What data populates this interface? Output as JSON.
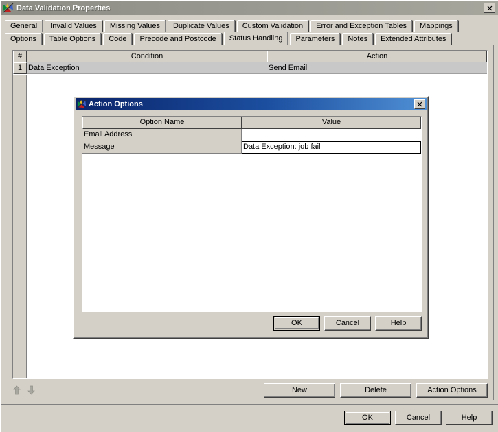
{
  "window": {
    "title": "Data Validation Properties",
    "icon": "app-butterfly-icon",
    "close_label": "✕"
  },
  "tabs": {
    "row1": [
      {
        "label": "General",
        "selected": false
      },
      {
        "label": "Invalid Values",
        "selected": false
      },
      {
        "label": "Missing Values",
        "selected": false
      },
      {
        "label": "Duplicate Values",
        "selected": false
      },
      {
        "label": "Custom Validation",
        "selected": false
      },
      {
        "label": "Error and Exception Tables",
        "selected": false
      },
      {
        "label": "Mappings",
        "selected": false
      }
    ],
    "row2": [
      {
        "label": "Options",
        "selected": false
      },
      {
        "label": "Table Options",
        "selected": false
      },
      {
        "label": "Code",
        "selected": false
      },
      {
        "label": "Precode and Postcode",
        "selected": false
      },
      {
        "label": "Status Handling",
        "selected": true
      },
      {
        "label": "Parameters",
        "selected": false
      },
      {
        "label": "Notes",
        "selected": false
      },
      {
        "label": "Extended Attributes",
        "selected": false
      }
    ]
  },
  "grid": {
    "headers": {
      "num": "#",
      "condition": "Condition",
      "action": "Action"
    },
    "rows": [
      {
        "num": "1",
        "condition": "Data Exception",
        "action": "Send Email"
      }
    ]
  },
  "toolbar": {
    "move_up_icon": "arrow-up-icon",
    "move_down_icon": "arrow-down-icon",
    "new_label": "New",
    "delete_label": "Delete",
    "action_options_label": "Action Options"
  },
  "footer": {
    "ok_label": "OK",
    "cancel_label": "Cancel",
    "help_label": "Help"
  },
  "dialog": {
    "title": "Action Options",
    "icon": "app-butterfly-icon",
    "close_label": "✕",
    "headers": {
      "name": "Option Name",
      "value": "Value"
    },
    "rows": [
      {
        "name": "Email Address",
        "value": "",
        "editing": false
      },
      {
        "name": "Message",
        "value": "Data Exception: job fail",
        "editing": true
      }
    ],
    "footer": {
      "ok_label": "OK",
      "cancel_label": "Cancel",
      "help_label": "Help"
    }
  },
  "colors": {
    "face": "#d4d0c8",
    "window_titlebar_inactive": "#9a9a92",
    "dialog_titlebar_active": "#0a246a",
    "selection_row": "#c8c8c8",
    "text": "#000000"
  }
}
